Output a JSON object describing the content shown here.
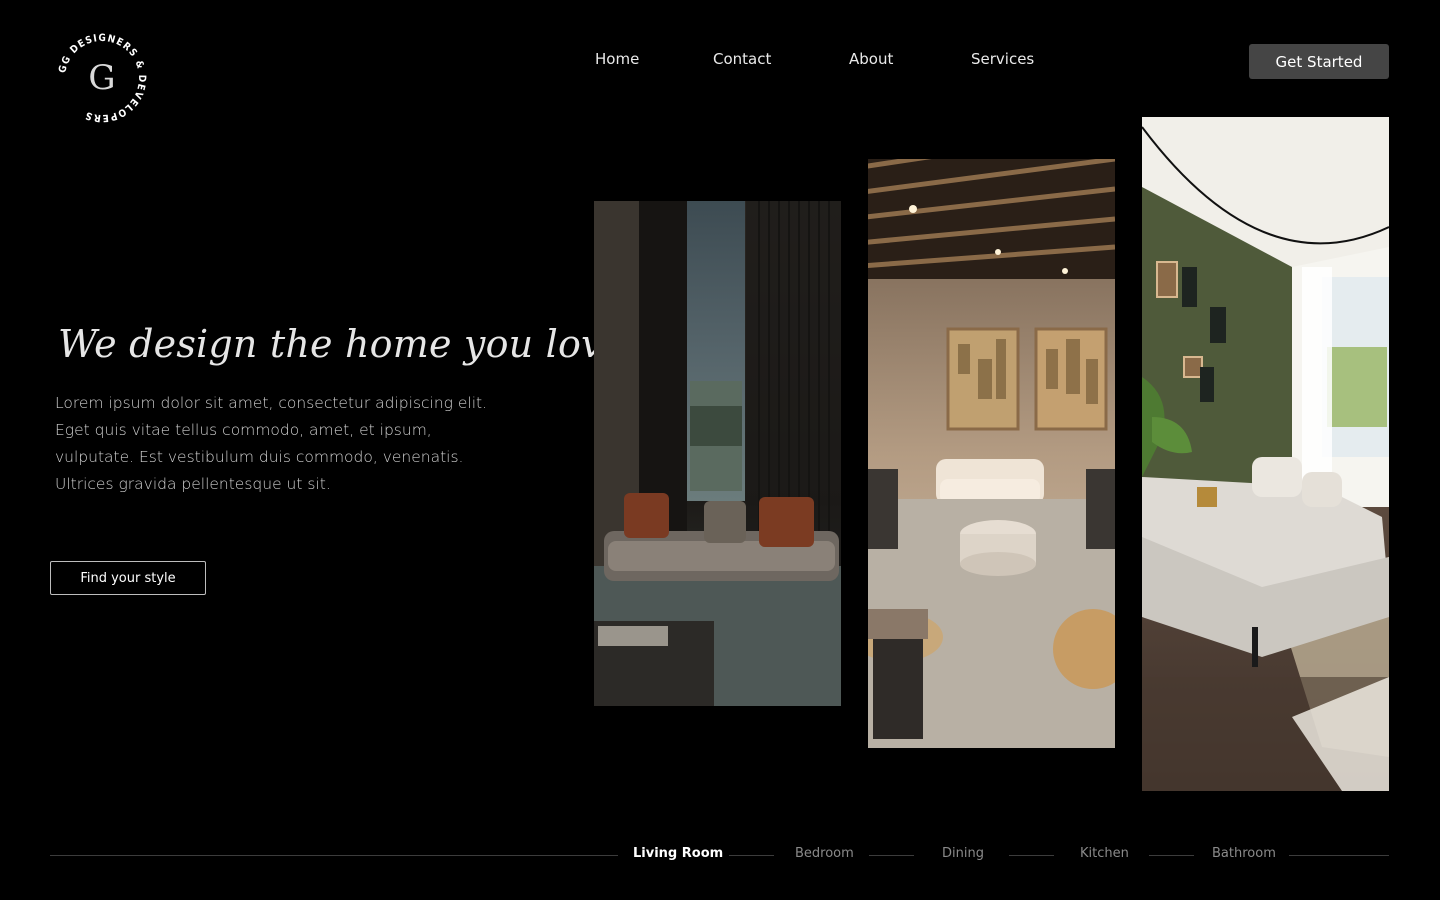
{
  "logo": {
    "ring_text": "GG DESIGNERS & DEVELOPERS",
    "monogram": "G"
  },
  "nav": {
    "items": [
      {
        "label": "Home"
      },
      {
        "label": "Contact"
      },
      {
        "label": "About"
      },
      {
        "label": "Services"
      }
    ],
    "cta_label": "Get Started"
  },
  "hero": {
    "headline": "We design the home you love",
    "body": "Lorem ipsum dolor sit amet, consectetur adipiscing elit. Eget quis vitae tellus commodo, amet, et ipsum, vulputate. Est vestibulum duis commodo, venenatis. Ultrices gravida pellentesque ut sit.",
    "button_label": "Find your style"
  },
  "gallery": {
    "images": [
      {
        "name": "dark-lounge-photo"
      },
      {
        "name": "warm-lobby-photo"
      },
      {
        "name": "green-wall-living-room-photo"
      }
    ]
  },
  "categories": {
    "items": [
      {
        "label": "Living Room",
        "active": true
      },
      {
        "label": "Bedroom",
        "active": false
      },
      {
        "label": "Dining",
        "active": false
      },
      {
        "label": "Kitchen",
        "active": false
      },
      {
        "label": "Bathroom",
        "active": false
      }
    ]
  },
  "colors": {
    "background": "#000000",
    "cta_background": "#454545",
    "text_primary": "#ffffff",
    "text_muted": "#8a8a8a"
  }
}
